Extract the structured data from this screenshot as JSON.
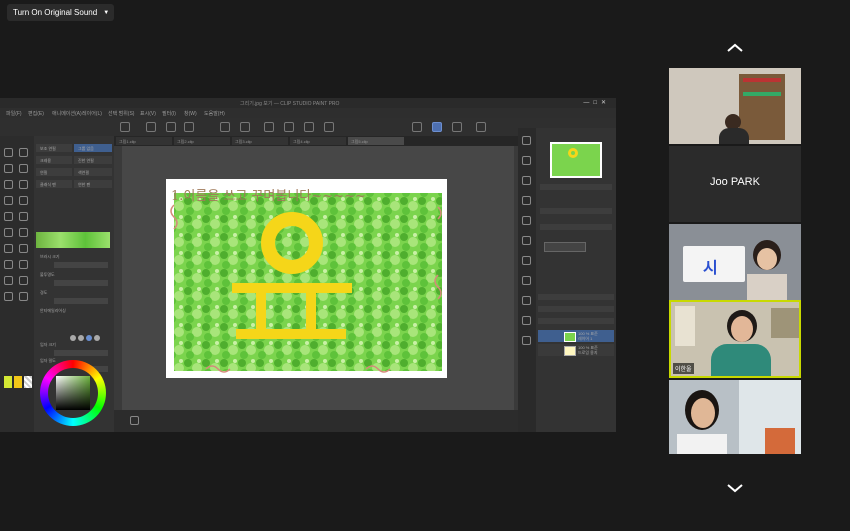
{
  "sound_button": {
    "label": "Turn On Original Sound"
  },
  "app": {
    "title": "그리기.jpg 보기 — CLIP STUDIO PAINT PRO",
    "menu": [
      "파일(F)",
      "편집(E)",
      "애니메이션(A)",
      "레이어(L)",
      "선택 범위(S)",
      "표시(V)",
      "필터(I)",
      "창(W)",
      "도움말(H)"
    ],
    "tabs": [
      "그림1.clip",
      "그림2.clip",
      "그림3.clip",
      "그림4.clip",
      "그림5.clip"
    ],
    "subtools": [
      "보조 연필",
      "그룹 없음",
      "크레용",
      "진한 연필",
      "연필",
      "색연필",
      "클래식 펜",
      "연한 펜"
    ],
    "settings_labels": [
      "브러시 크기",
      "불투명도",
      "경도",
      "안티에일리어싱",
      "입자 크기",
      "입자 밀도"
    ],
    "layers": [
      {
        "name": "100 % 표준",
        "sub": "레이어 1"
      },
      {
        "name": "100 % 표준",
        "sub": "드로잉 용지"
      }
    ],
    "colors": {
      "main": "#d4e834",
      "sub": "#f2c718",
      "accent": "#6db33f"
    }
  },
  "canvas": {
    "text": "1.이름을 쓰고 꾸며봅니다~~~~~",
    "colors": {
      "background": "#ffffff",
      "grass": "#5ec23a",
      "grass_light": "#9be06c",
      "sun": "#f5d619",
      "scribble": "#d48a7a"
    }
  },
  "participants": [
    {
      "name": "",
      "tile": "self-video"
    },
    {
      "name": "Joo PARK",
      "tile": "name-only"
    },
    {
      "name": "",
      "tile": "kid-sign"
    },
    {
      "name": "이한울",
      "tile": "speaker-active"
    },
    {
      "name": "",
      "tile": "kid-bottom"
    }
  ],
  "icons": {
    "up": "chevron-up-icon",
    "down": "chevron-down-icon"
  }
}
